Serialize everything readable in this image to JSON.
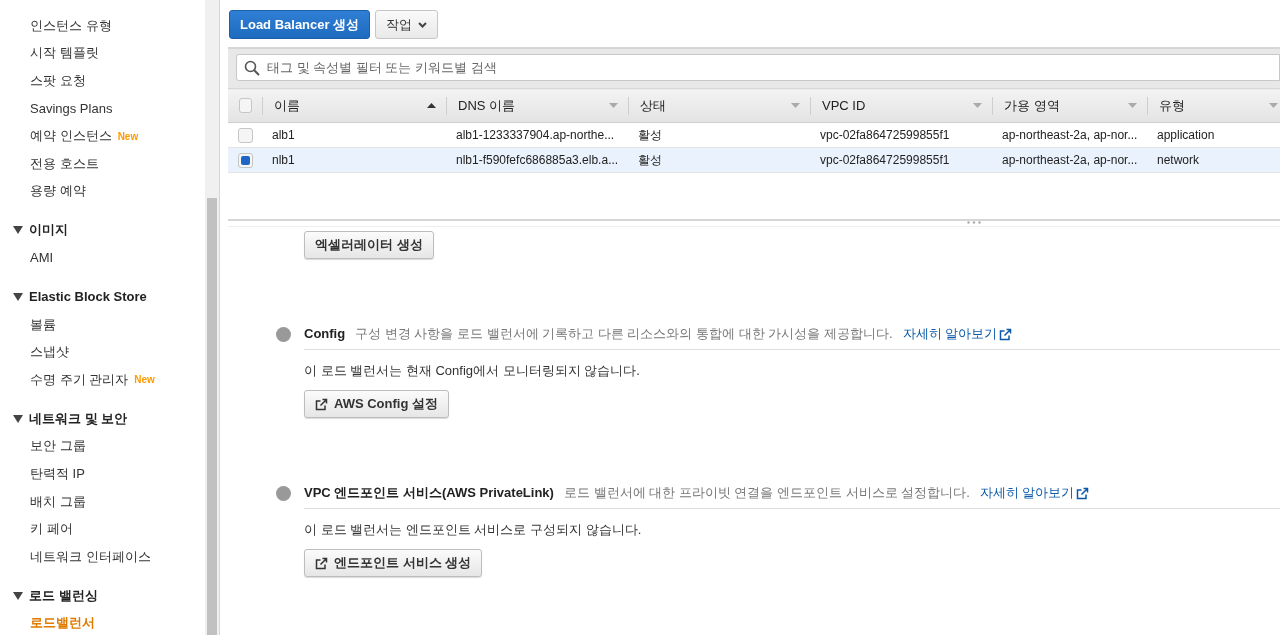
{
  "sidebar": {
    "sections": [
      {
        "items": [
          {
            "label": "인스턴스 유형",
            "selected": false
          },
          {
            "label": "시작 템플릿",
            "selected": false
          },
          {
            "label": "스팟 요청",
            "selected": false
          },
          {
            "label": "Savings Plans",
            "selected": false
          },
          {
            "label": "예약 인스턴스",
            "badge": "New",
            "selected": false
          },
          {
            "label": "전용 호스트",
            "selected": false
          },
          {
            "label": "용량 예약",
            "selected": false
          }
        ]
      },
      {
        "heading": "이미지",
        "expanded": true,
        "items": [
          {
            "label": "AMI",
            "selected": false
          }
        ]
      },
      {
        "heading": "Elastic Block Store",
        "expanded": true,
        "items": [
          {
            "label": "볼륨",
            "selected": false
          },
          {
            "label": "스냅샷",
            "selected": false
          },
          {
            "label": "수명 주기 관리자",
            "badge": "New",
            "selected": false
          }
        ]
      },
      {
        "heading": "네트워크 및 보안",
        "expanded": true,
        "items": [
          {
            "label": "보안 그룹",
            "selected": false
          },
          {
            "label": "탄력적 IP",
            "selected": false
          },
          {
            "label": "배치 그룹",
            "selected": false
          },
          {
            "label": "키 페어",
            "selected": false
          },
          {
            "label": "네트워크 인터페이스",
            "selected": false
          }
        ]
      },
      {
        "heading": "로드 밸런싱",
        "expanded": true,
        "items": [
          {
            "label": "로드밸런서",
            "selected": true
          }
        ]
      }
    ]
  },
  "toolbar": {
    "create_button": "Load Balancer 생성",
    "actions_button": "작업"
  },
  "search": {
    "placeholder": "태그 및 속성별 필터 또는 키워드별 검색"
  },
  "table": {
    "all_checked": false,
    "columns": [
      {
        "label": "이름",
        "sorted": true
      },
      {
        "label": "DNS 이름",
        "sorted": false
      },
      {
        "label": "상태",
        "sorted": false
      },
      {
        "label": "VPC ID",
        "sorted": false
      },
      {
        "label": "가용 영역",
        "sorted": false
      },
      {
        "label": "유형",
        "sorted": false
      }
    ],
    "rows": [
      {
        "selected": false,
        "cells": [
          "alb1",
          "alb1-1233337904.ap-northe...",
          "활성",
          "vpc-02fa86472599855f1",
          "ap-northeast-2a, ap-nor...",
          "application"
        ]
      },
      {
        "selected": true,
        "cells": [
          "nlb1",
          "nlb1-f590fefc686885a3.elb.a...",
          "활성",
          "vpc-02fa86472599855f1",
          "ap-northeast-2a, ap-nor...",
          "network"
        ]
      }
    ]
  },
  "details": {
    "accelerator_button": "엑셀러레이터 생성",
    "sections": [
      {
        "title": "Config",
        "description": "구성 변경 사항을 로드 밸런서에 기록하고 다른 리소스와의 통합에 대한 가시성을 제공합니다.",
        "link": "자세히 알아보기",
        "status_text": "이 로드 밸런서는 현재 Config에서 모니터링되지 않습니다.",
        "button": "AWS Config 설정"
      },
      {
        "title": "VPC 엔드포인트 서비스(AWS PrivateLink)",
        "description": "로드 밸런서에 대한 프라이빗 연결을 엔드포인트 서비스로 설정합니다.",
        "link": "자세히 알아보기",
        "status_text": "이 로드 밸런서는 엔드포인트 서비스로 구성되지 않습니다.",
        "button": "엔드포인트 서비스 생성"
      }
    ]
  }
}
